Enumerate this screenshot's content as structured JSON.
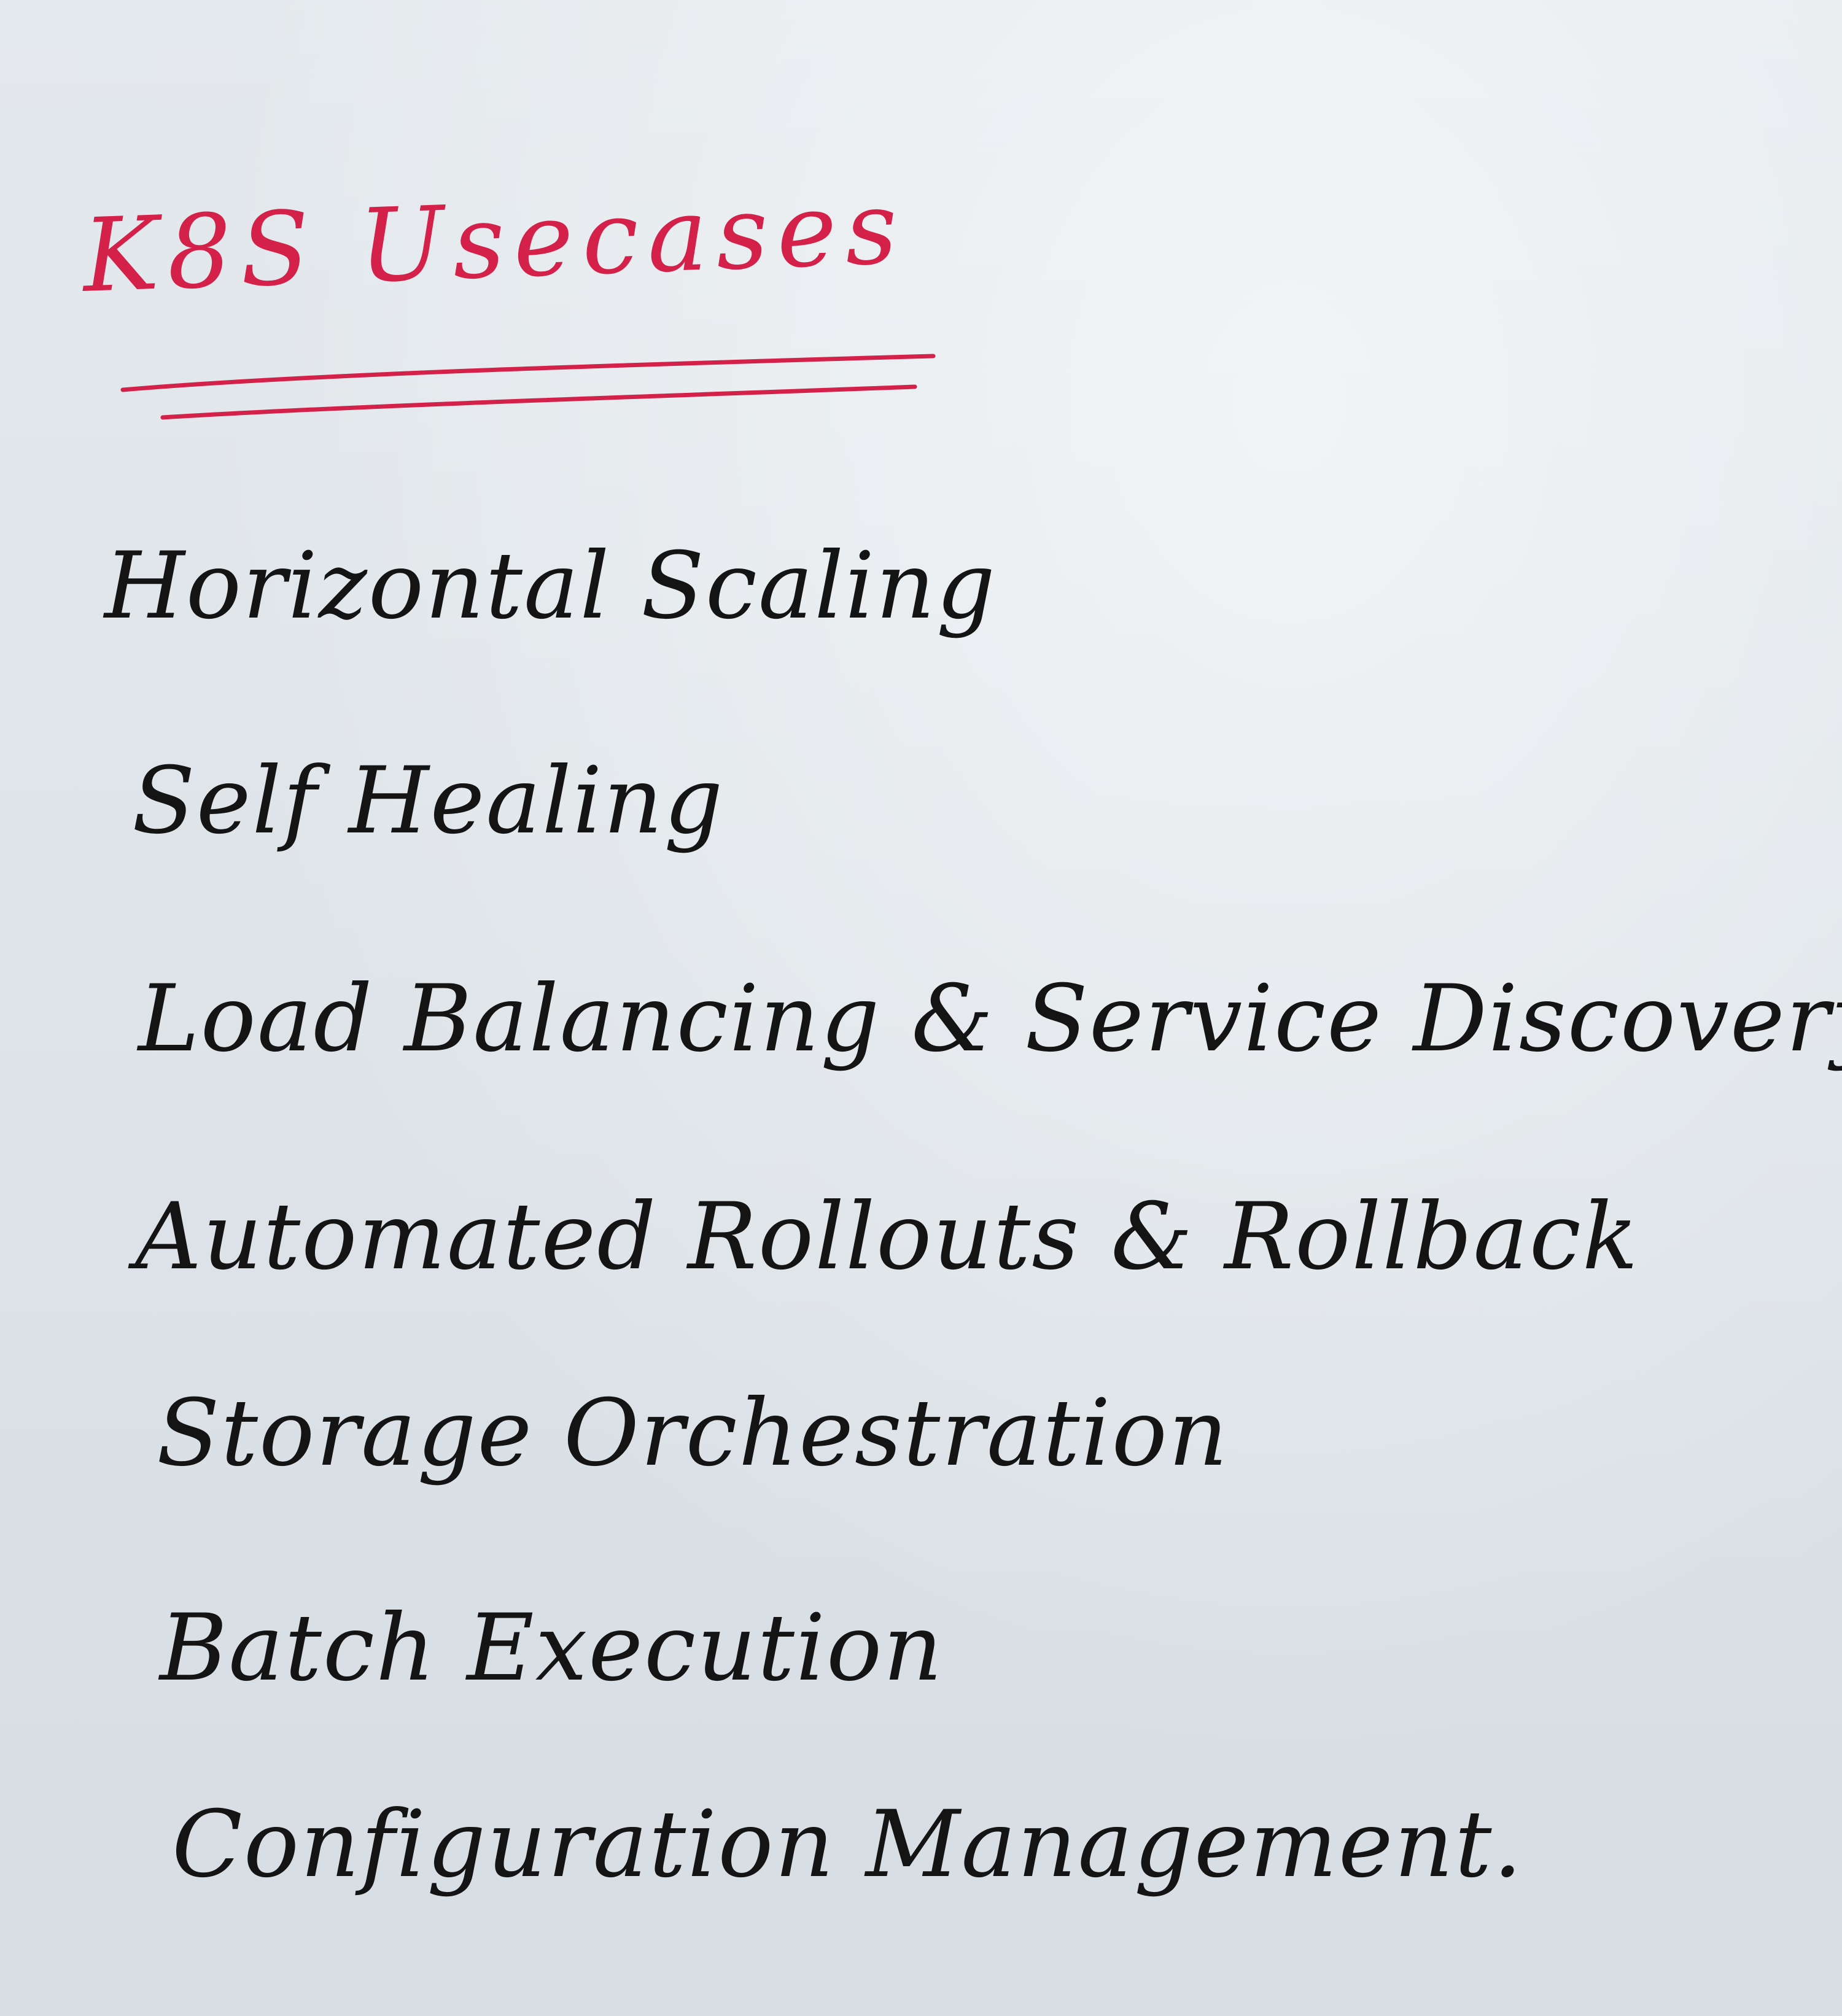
{
  "note": {
    "heading": "K8S Usecases",
    "items": [
      "Horizontal Scaling",
      "Self Healing",
      "Load Balancing & Service Discovery",
      "Automated Rollouts & Rollback",
      "Storage Orchestration",
      "Batch Execution",
      "Configuration Management."
    ]
  },
  "colors": {
    "heading_ink": "#d4214a",
    "body_ink": "#141414",
    "paper": "#dfe5ea"
  }
}
